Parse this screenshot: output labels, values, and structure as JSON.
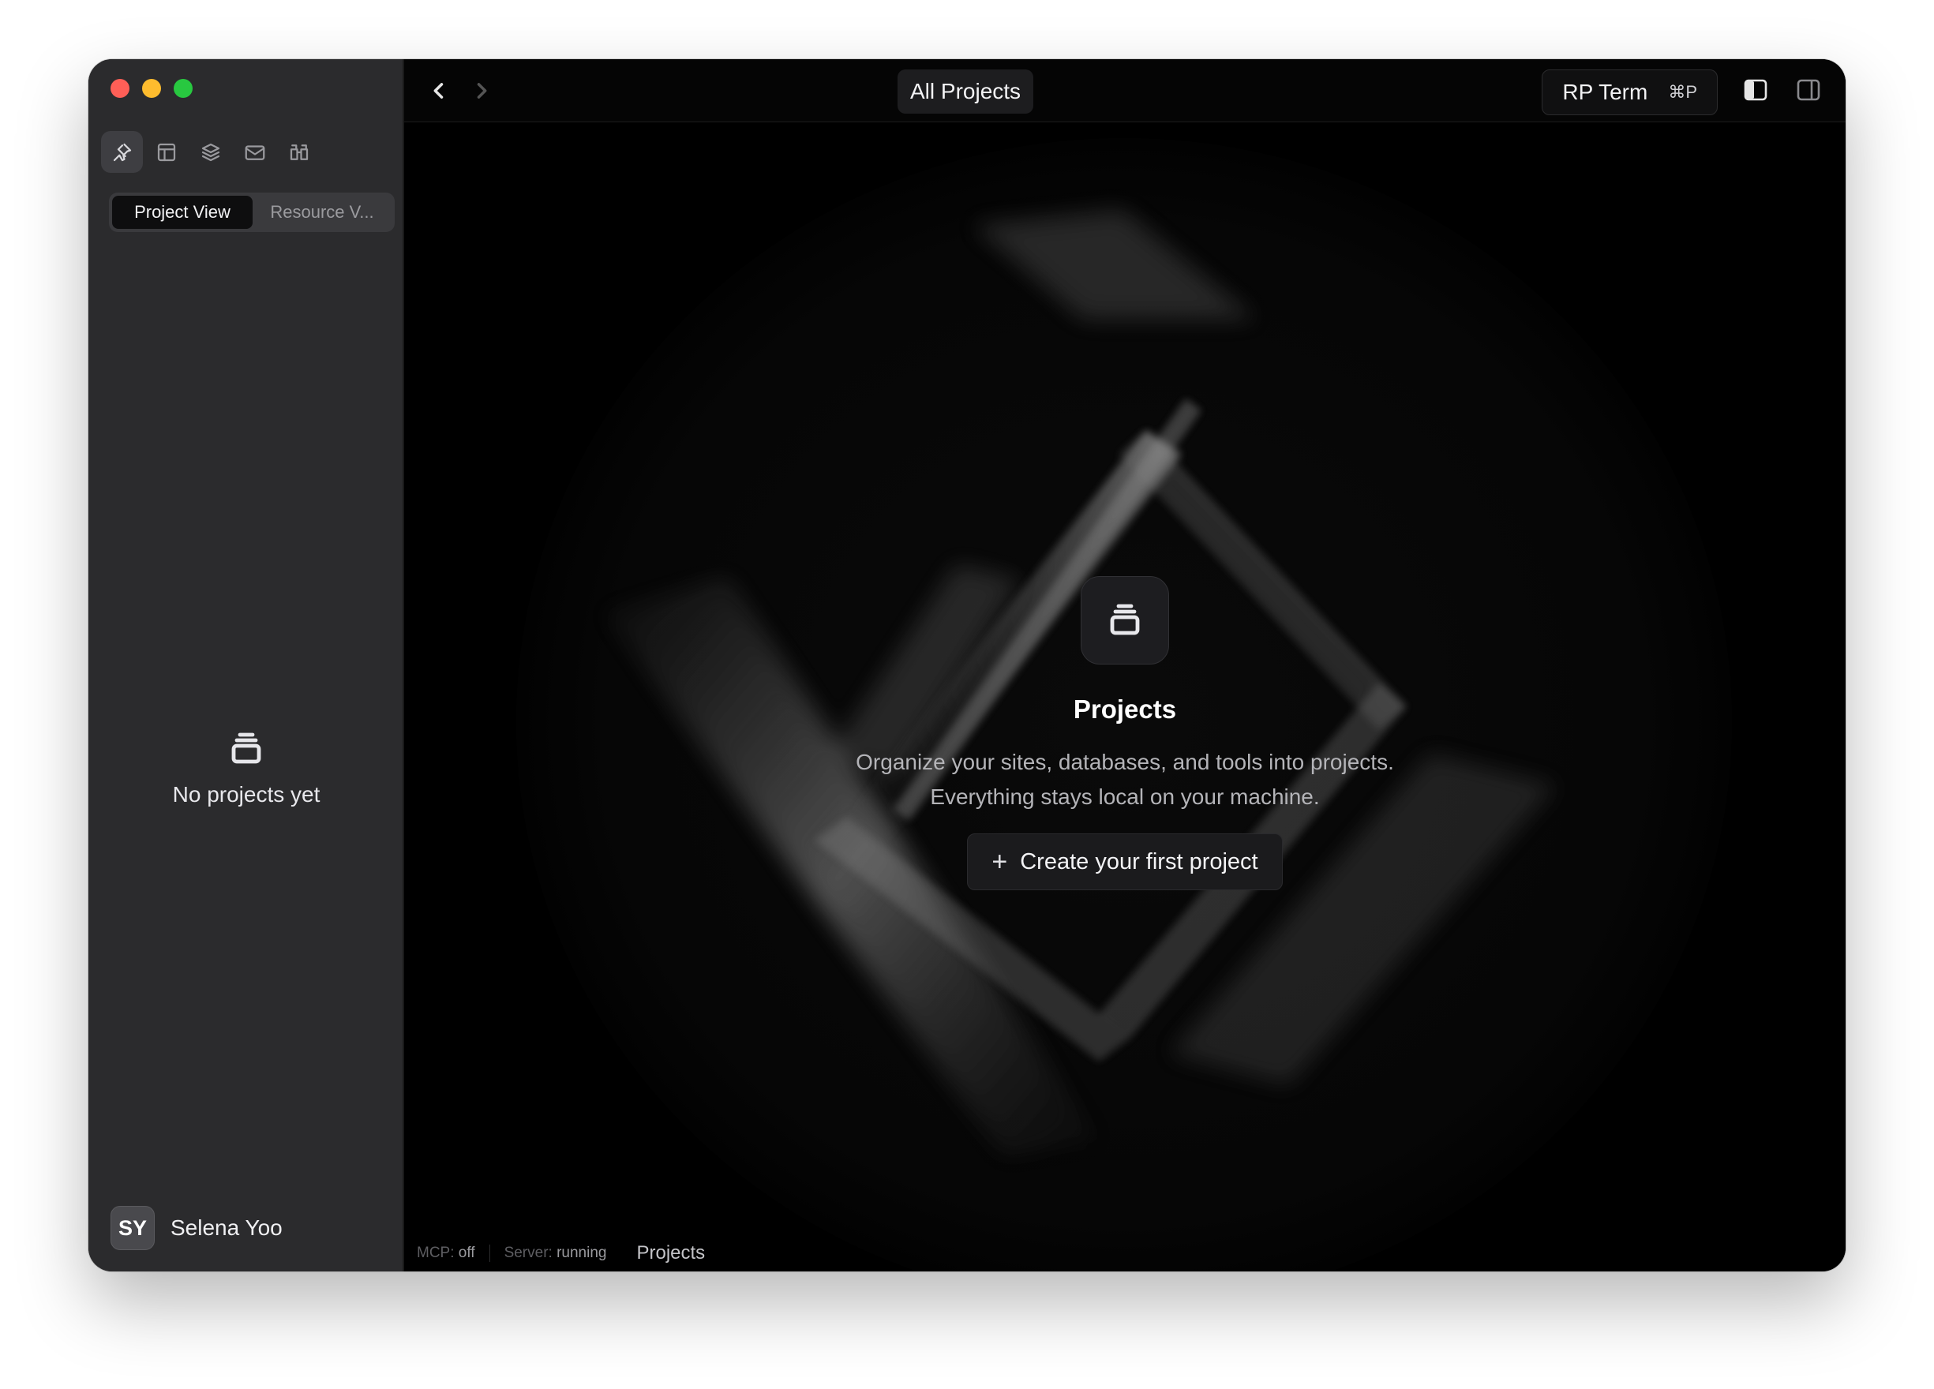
{
  "window": {
    "traffic_lights": [
      "close",
      "minimize",
      "zoom"
    ],
    "colors": {
      "close": "#fe5f57",
      "minimize": "#febc2e",
      "zoom": "#28c840"
    }
  },
  "sidebar": {
    "tools": [
      {
        "icon": "pin-icon",
        "active": true
      },
      {
        "icon": "layout-icon",
        "active": false
      },
      {
        "icon": "layers-icon",
        "active": false
      },
      {
        "icon": "mail-icon",
        "active": false
      },
      {
        "icon": "binoculars-icon",
        "active": false
      }
    ],
    "segmented": {
      "project_view": "Project View",
      "resource_view": "Resource V..."
    },
    "empty": {
      "icon": "stack-icon",
      "text": "No projects yet"
    },
    "user": {
      "initials": "SY",
      "name": "Selena Yoo"
    }
  },
  "titlebar": {
    "title": "All Projects",
    "rp_term": {
      "label": "RP Term",
      "shortcut": "⌘P"
    }
  },
  "main": {
    "icon": "stack-icon",
    "title": "Projects",
    "description": "Organize your sites, databases, and tools into projects. Everything stays local on your machine.",
    "create_button": {
      "icon": "+",
      "label": "Create your first project"
    }
  },
  "statusbar": {
    "mcp_key": "MCP:",
    "mcp_value": "off",
    "server_key": "Server:",
    "server_value": "running",
    "breadcrumb": "Projects"
  }
}
